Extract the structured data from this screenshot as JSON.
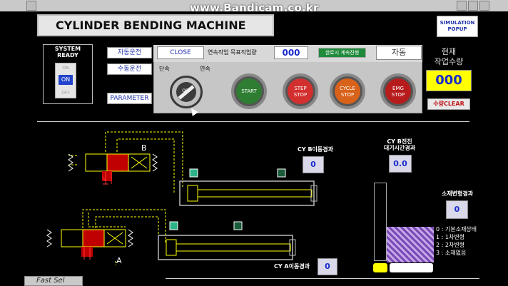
{
  "watermark": "www.Bandicam.co.kr",
  "title": "CYLINDER BENDING MACHINE",
  "simulation_popup": "SIMULATION POPUP",
  "system_ready": {
    "label": "SYSTEM READY",
    "switch_on": "ON",
    "switch_top": "ON",
    "switch_bottom": "OFF"
  },
  "mode_buttons": {
    "auto": "자동운전",
    "manual": "수동운전",
    "parameter": "PARAMETER"
  },
  "panel": {
    "close": "CLOSE",
    "target_label": "연속작업 목표작업량",
    "target_value": "000",
    "green_btn": "완료시 계속진행",
    "mode_value": "자동",
    "single_label": "단속",
    "continuous_label": "연속",
    "selector_off": "OFF",
    "start": "START",
    "step_stop": "STEP STOP",
    "cycle_stop": "CYCLE STOP",
    "emg_stop": "EMG STOP"
  },
  "current_count": {
    "label_line1": "현재",
    "label_line2": "작업수량",
    "value": "000",
    "clear": "수량CLEAR"
  },
  "hydraulic": {
    "label_b": "B",
    "label_a": "A"
  },
  "cy_b": {
    "label": "CY B이동경과",
    "value": "0"
  },
  "cy_b_wait": {
    "label_line1": "CY B전진",
    "label_line2": "대기시간경과",
    "value": "0.0"
  },
  "cy_a": {
    "label": "CY A이동경과",
    "value": "0"
  },
  "material": {
    "label": "소재변형경과",
    "value": "0",
    "legend": [
      "0 : 기본소재상태",
      "1 : 1차변형",
      "2 : 2차변형",
      "3 : 소재없음"
    ]
  },
  "fast_sel": "Fast Sel"
}
